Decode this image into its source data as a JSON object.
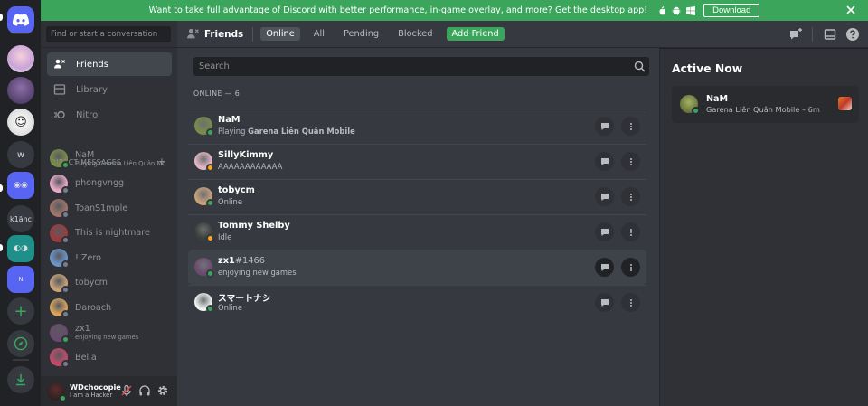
{
  "banner": {
    "message": "Want to take full advantage of Discord with better performance, in-game overlay, and more? Get the desktop app!",
    "download_label": "Download",
    "color": "#3ba55c"
  },
  "servers": [
    {
      "kind": "home",
      "icon": "discord-logo-icon"
    },
    {
      "kind": "image",
      "icon": "anime-girl-avatar"
    },
    {
      "kind": "image",
      "icon": "purple-anime-avatar"
    },
    {
      "kind": "image",
      "icon": "trollface-avatar"
    },
    {
      "kind": "text",
      "label": "w"
    },
    {
      "kind": "image",
      "icon": "server-avatar"
    },
    {
      "kind": "text",
      "label": "k1änc"
    },
    {
      "kind": "image",
      "icon": "teal-server-avatar"
    },
    {
      "kind": "text",
      "label": "N"
    },
    {
      "kind": "action",
      "icon": "plus-icon"
    },
    {
      "kind": "action",
      "icon": "compass-icon"
    },
    {
      "kind": "action",
      "icon": "download-icon"
    }
  ],
  "sidebar": {
    "search_placeholder": "Find or start a conversation",
    "nav": [
      {
        "label": "Friends",
        "icon": "friends-icon"
      },
      {
        "label": "Library",
        "icon": "library-icon"
      },
      {
        "label": "Nitro",
        "icon": "nitro-icon"
      }
    ],
    "dm_header": "DIRECT MESSAGES",
    "dms": [
      {
        "name": "NaM",
        "sub": "Playing Garena Liên Quân Mo...",
        "status": "on",
        "color": "#7a8c4a"
      },
      {
        "name": "phongvngg",
        "sub": "",
        "status": "off",
        "color": "#e9a9c8"
      },
      {
        "name": "ToanS1mple",
        "sub": "",
        "status": "off",
        "color": "#a0756a"
      },
      {
        "name": "This is nightmare",
        "sub": "",
        "status": "off",
        "color": "#9c3b3b"
      },
      {
        "name": "! Zero",
        "sub": "",
        "status": "off",
        "color": "#6b95c9"
      },
      {
        "name": "tobycm",
        "sub": "",
        "status": "off",
        "color": "#c9a27a"
      },
      {
        "name": "Daroach",
        "sub": "",
        "status": "off",
        "color": "#d9a45c"
      },
      {
        "name": "zx1",
        "sub": "enjoying new games",
        "status": "on",
        "color": "#6a4a6e"
      },
      {
        "name": "Bella",
        "sub": "",
        "status": "off",
        "color": "#c44a6a"
      }
    ]
  },
  "user": {
    "name": "WDchocopie",
    "tag": "I am a Hacker"
  },
  "header": {
    "title": "Friends",
    "tabs": [
      "Online",
      "All",
      "Pending",
      "Blocked"
    ],
    "add_friend": "Add Friend"
  },
  "friends": {
    "search_placeholder": "Search",
    "count_label": "ONLINE — 6",
    "list": [
      {
        "name": "NaM",
        "disc": "",
        "sub_prefix": "Playing ",
        "sub_bold": "Garena Liên Quân Mobile",
        "status": "on",
        "color": "#7a8c4a"
      },
      {
        "name": "SillyKimmy",
        "disc": "",
        "sub_prefix": "AAAAAAAAAAAA",
        "sub_bold": "",
        "status": "idle",
        "color": "#e6b7c4"
      },
      {
        "name": "tobycm",
        "disc": "",
        "sub_prefix": "Online",
        "sub_bold": "",
        "status": "on",
        "color": "#c9a27a"
      },
      {
        "name": "Tommy Shelby",
        "disc": "",
        "sub_prefix": "Idle",
        "sub_bold": "",
        "status": "idle",
        "color": "#3b3f3a"
      },
      {
        "name": "zx1",
        "disc": "#1466",
        "sub_prefix": "enjoying new games",
        "sub_bold": "",
        "status": "on",
        "color": "#6a4a6e"
      },
      {
        "name": "スマートナシ",
        "disc": "",
        "sub_prefix": "Online",
        "sub_bold": "",
        "status": "on",
        "color": "#f2f2f2"
      }
    ]
  },
  "active_now": {
    "title": "Active Now",
    "card": {
      "name": "NaM",
      "sub": "Garena Liên Quân Mobile – 6m"
    }
  }
}
